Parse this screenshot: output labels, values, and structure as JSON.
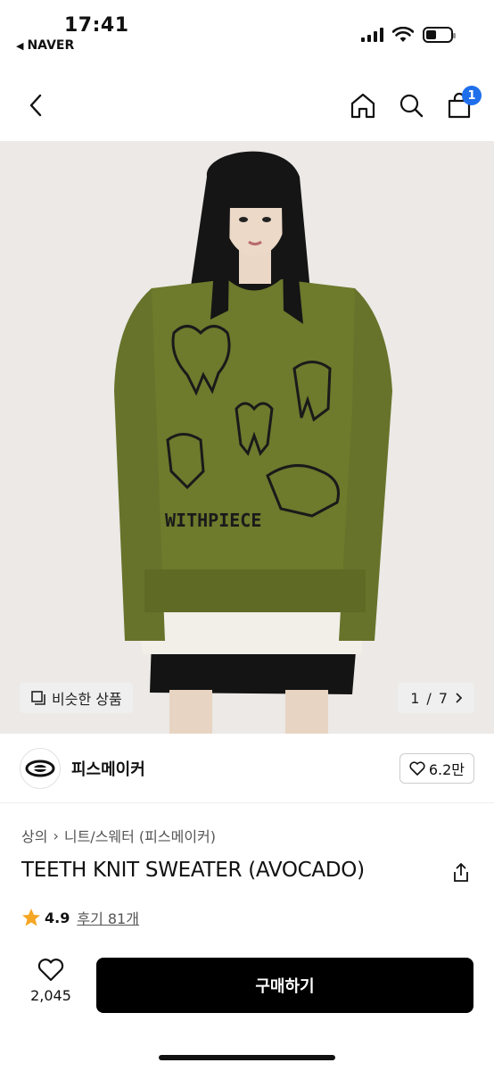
{
  "status_bar": {
    "time": "17:41",
    "back_app": "NAVER"
  },
  "nav": {
    "cart_count": "1",
    "icons": [
      "back-icon",
      "home-icon",
      "search-icon",
      "cart-icon"
    ]
  },
  "hero": {
    "similar_label": "비슷한 상품",
    "page_current": "1",
    "page_total": "7",
    "sweater_text": "WITHPIECE",
    "colors": {
      "background": "#ece9e6",
      "sweater": "#6e7a2c"
    }
  },
  "brand": {
    "name": "피스메이커",
    "likes": "6.2만"
  },
  "product": {
    "breadcrumb": [
      "상의",
      "니트/스웨터 (피스메이커)"
    ],
    "title": "TEETH KNIT SWEATER (AVOCADO)",
    "rating": "4.9",
    "reviews_label": "후기 81개"
  },
  "bottom": {
    "wish_count": "2,045",
    "buy_label": "구매하기"
  },
  "colors": {
    "star": "#f5a623",
    "badge": "#1f6feb",
    "button": "#000000"
  }
}
